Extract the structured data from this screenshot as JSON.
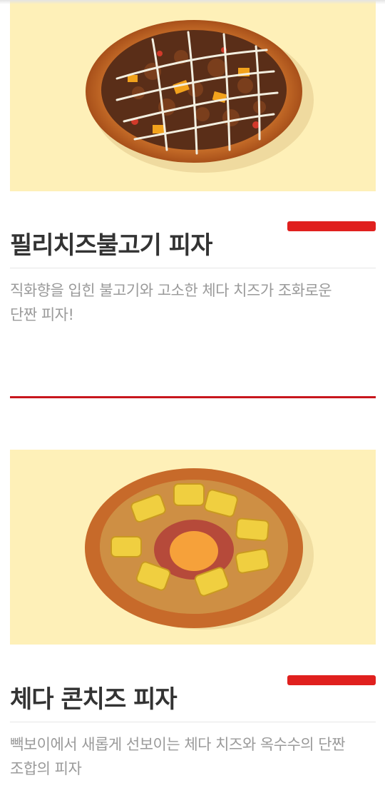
{
  "menu": {
    "items": [
      {
        "name": "필리치즈불고기 피자",
        "description_line1": "직화향을 입힌 불고기와 고소한 체다 치즈가 조화로운",
        "description_line2": "단짠 피자!",
        "image_icon": "pizza-bulgogi-image"
      },
      {
        "name": "체다 콘치즈 피자",
        "description_line1": "빽보이에서 새롭게 선보이는 체다 치즈와 옥수수의 단짠",
        "description_line2": "조합의 피자",
        "image_icon": "pizza-corn-image"
      }
    ]
  },
  "colors": {
    "accent_red": "#e0201e",
    "divider_red": "#c8161d",
    "image_background": "#fef0b8",
    "title_text": "#333333",
    "description_text": "#9a9a9a"
  }
}
